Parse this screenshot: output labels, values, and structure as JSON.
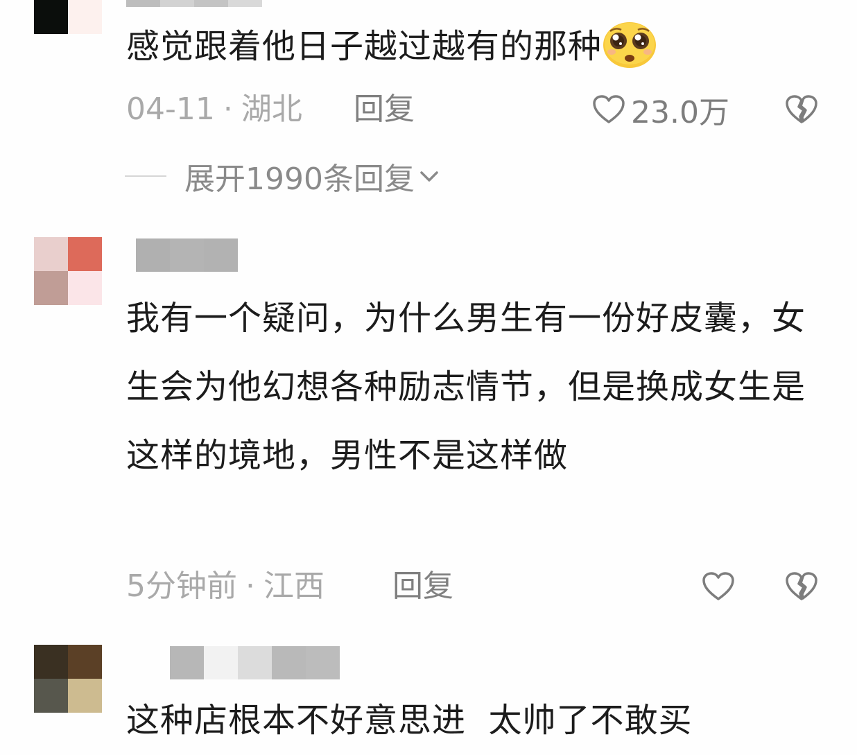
{
  "comments": [
    {
      "text": "感觉跟着他日子越过越有的那种",
      "emoji": "pleading-face-emoji",
      "date": "04-11",
      "location": "湖北",
      "reply_label": "回复",
      "likes": "23.0万",
      "expand_label": "展开1990条回复"
    },
    {
      "text": "我有一个疑问，为什么男生有一份好皮囊，女生会为他幻想各种励志情节，但是换成女生是这样的境地，男性不是这样做",
      "date": "5分钟前",
      "location": "江西",
      "reply_label": "回复"
    },
    {
      "text": "这种店根本不好意思进  太帅了不敢买"
    }
  ],
  "separator": "·",
  "colors": {
    "meta_text": "#a9a9a9",
    "icon_gray": "#7d7d7d"
  }
}
